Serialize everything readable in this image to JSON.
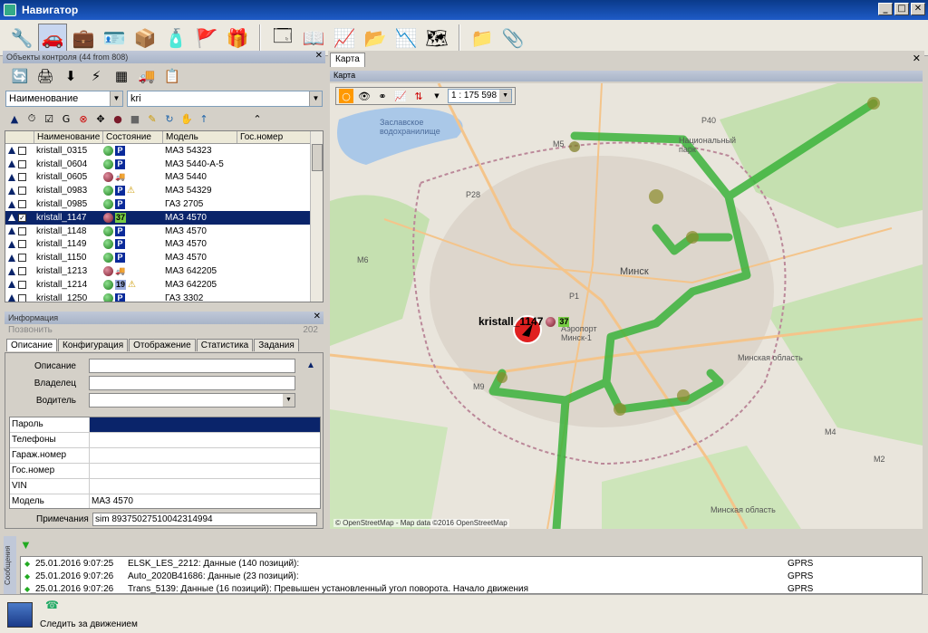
{
  "window": {
    "title": "Навигатор",
    "min": "_",
    "max": "□",
    "close": "✕"
  },
  "left_panel": {
    "objects_header": "Объекты контроля (44 from 808)",
    "filter_field": "Наименование",
    "filter_value": "kri",
    "columns": [
      "Наименование",
      "Состояние",
      "Модель",
      "Гос.номер"
    ],
    "rows": [
      {
        "name": "kristall_0315",
        "dot": "green",
        "badge": "P",
        "warn": "",
        "model": "МАЗ 54323",
        "checked": ""
      },
      {
        "name": "kristall_0604",
        "dot": "green",
        "badge": "P",
        "warn": "",
        "model": "МАЗ 5440-А-5",
        "checked": ""
      },
      {
        "name": "kristall_0605",
        "dot": "red",
        "badge": "",
        "warn": "",
        "model": "МАЗ 5440",
        "checked": ""
      },
      {
        "name": "kristall_0983",
        "dot": "green",
        "badge": "P",
        "warn": "⚠",
        "model": "МАЗ 54329",
        "checked": ""
      },
      {
        "name": "kristall_0985",
        "dot": "green",
        "badge": "P",
        "warn": "",
        "model": "ГАЗ 2705",
        "checked": ""
      },
      {
        "name": "kristall_1147",
        "dot": "red",
        "badge": "37",
        "warn": "",
        "model": "МАЗ 4570",
        "checked": "✓"
      },
      {
        "name": "kristall_1148",
        "dot": "green",
        "badge": "P",
        "warn": "",
        "model": "МАЗ 4570",
        "checked": ""
      },
      {
        "name": "kristall_1149",
        "dot": "green",
        "badge": "P",
        "warn": "",
        "model": "МАЗ 4570",
        "checked": ""
      },
      {
        "name": "kristall_1150",
        "dot": "green",
        "badge": "P",
        "warn": "",
        "model": "МАЗ 4570",
        "checked": ""
      },
      {
        "name": "kristall_1213",
        "dot": "red",
        "badge": "",
        "warn": "",
        "model": "МАЗ 642205",
        "checked": ""
      },
      {
        "name": "kristall_1214",
        "dot": "green",
        "badge": "19",
        "warn": "⚠",
        "model": "МАЗ 642205",
        "checked": ""
      },
      {
        "name": "kristall_1250",
        "dot": "green",
        "badge": "P",
        "warn": "",
        "model": "ГАЗ 3302",
        "checked": ""
      }
    ],
    "selected_row": 5,
    "info_header": "Информация",
    "call_label": "Позвонить",
    "call_number": "202",
    "tabs": [
      "Описание",
      "Конфигурация",
      "Отображение",
      "Статистика",
      "Задания"
    ],
    "fields": {
      "description_label": "Описание",
      "owner_label": "Владелец",
      "driver_label": "Водитель"
    },
    "props": [
      {
        "k": "Пароль",
        "v": ""
      },
      {
        "k": "Телефоны",
        "v": ""
      },
      {
        "k": "Гараж.номер",
        "v": ""
      },
      {
        "k": "Гос.номер",
        "v": ""
      },
      {
        "k": "VIN",
        "v": ""
      },
      {
        "k": "Модель",
        "v": "МАЗ 4570"
      }
    ],
    "note_label": "Примечания",
    "note_value": "sim 89375027510042314994"
  },
  "map": {
    "tab": "Карта",
    "header": "Карта",
    "scale": "1 : 175 598",
    "vehicle_label": "kristall_1147",
    "vehicle_badge": "37",
    "labels": {
      "reservoir": "Заславское водохранилище",
      "city": "Минск",
      "region": "Минская область",
      "region2": "Минская область",
      "airport": "Аэропорт Минск-1",
      "nat_park": "Национальный парк",
      "m9": "M9",
      "m6": "M6",
      "m5": "M5",
      "p28": "P28",
      "p40": "P40",
      "p1": "P1",
      "m4": "M4",
      "m2": "M2"
    },
    "copyright": "© OpenStreetMap - Map data ©2016 OpenStreetMap"
  },
  "log": {
    "side_label": "Сообщения",
    "rows": [
      {
        "time": "25.01.2016 9:07:25",
        "msg": "ELSK_LES_2212: Данные (140 позиций):",
        "ch": "GPRS"
      },
      {
        "time": "25.01.2016 9:07:26",
        "msg": "Auto_2020B41686: Данные (23 позиций):",
        "ch": "GPRS"
      },
      {
        "time": "25.01.2016 9:07:26",
        "msg": "Trans_5139: Данные (16 позиций): Превышен установленный угол поворота. Начало движения",
        "ch": "GPRS"
      }
    ]
  },
  "status": {
    "text": "Следить за движением"
  }
}
